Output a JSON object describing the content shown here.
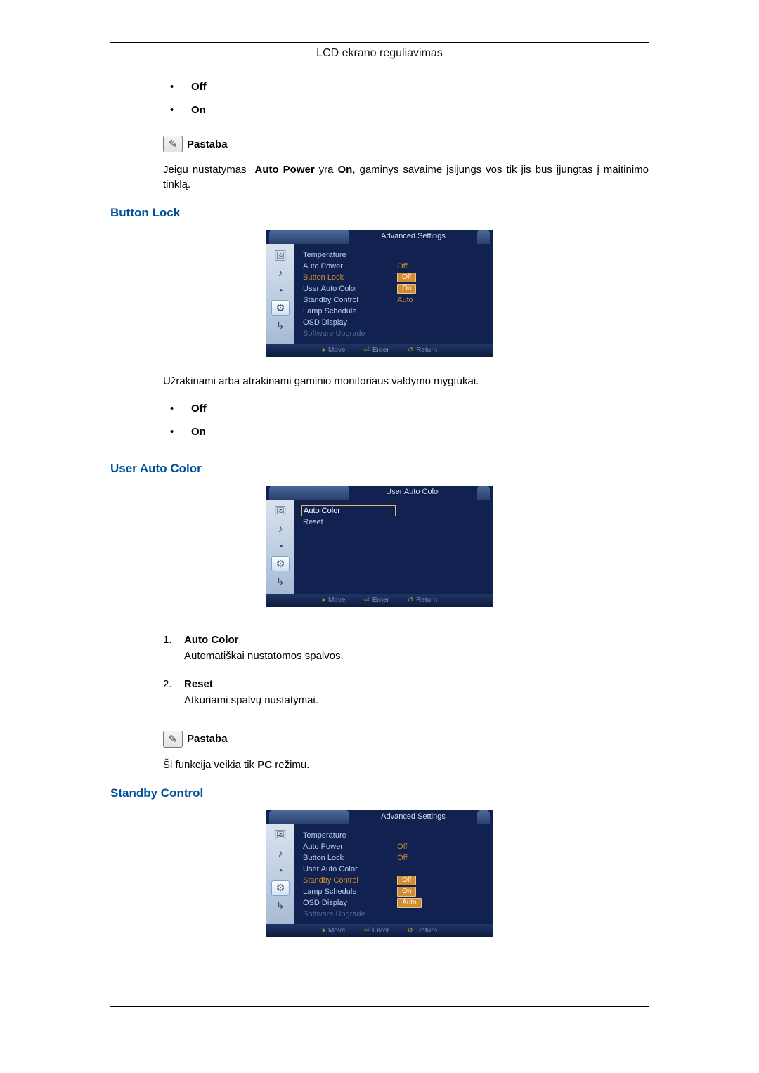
{
  "header": {
    "title": "LCD ekrano reguliavimas"
  },
  "options": {
    "off": "Off",
    "on": "On"
  },
  "notes": {
    "label": "Pastaba"
  },
  "autopower": {
    "note": "Jeigu nustatymas Auto Power yra On, gaminys savaime įsijungs vos tik jis bus įjungtas į maitinimo tinklą.",
    "kw1": "Auto Power",
    "kw2": "On"
  },
  "buttonlock": {
    "heading": "Button Lock",
    "desc": "Užrakinami arba atrakinami gaminio monitoriaus valdymo mygtukai."
  },
  "userauto": {
    "heading": "User Auto Color",
    "item1_title": "Auto Color",
    "item1_desc": "Automatiškai nustatomos spalvos.",
    "item2_title": "Reset",
    "item2_desc": "Atkuriami spalvų nustatymai.",
    "note_pre": "Ši funkcija veikia tik ",
    "note_kw": "PC",
    "note_post": " režimu."
  },
  "standby": {
    "heading": "Standby Control"
  },
  "osd": {
    "title": "Advanced Settings",
    "rows": {
      "temperature": "Temperature",
      "auto_power": "Auto Power",
      "button_lock": "Button Lock",
      "user_auto_color": "User Auto Color",
      "standby_control": "Standby Control",
      "lamp_schedule": "Lamp Schedule",
      "osd_display": "OSD Display",
      "software_upgrade": "Software Upgrade"
    },
    "vals": {
      "off": "Off",
      "on": "On",
      "auto": "Auto"
    },
    "colon": ":",
    "foot": {
      "move": "Move",
      "enter": "Enter",
      "return": "Return"
    }
  },
  "osd2": {
    "title": "User Auto Color",
    "rows": {
      "auto_color": "Auto Color",
      "reset": "Reset"
    }
  }
}
